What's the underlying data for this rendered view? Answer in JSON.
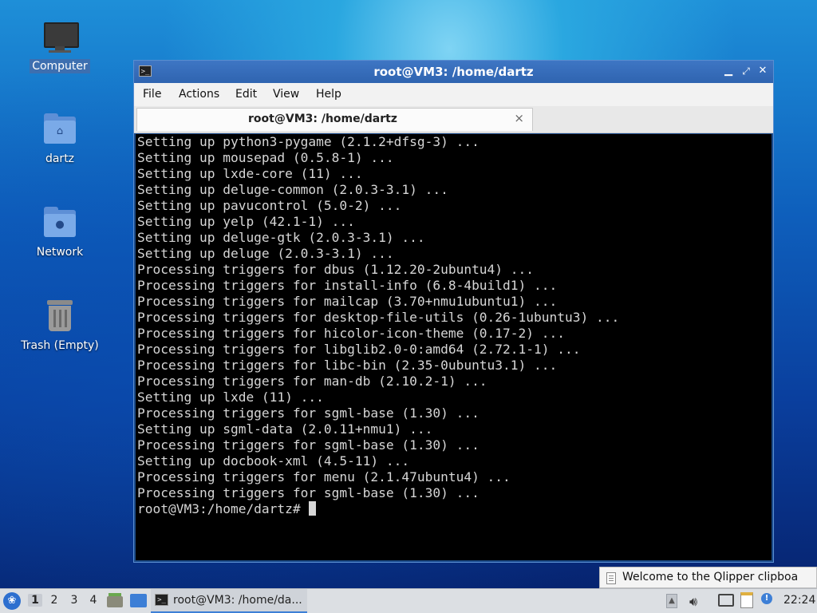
{
  "desktop": {
    "icons": [
      {
        "label": "Computer"
      },
      {
        "label": "dartz"
      },
      {
        "label": "Network"
      },
      {
        "label": "Trash (Empty)"
      }
    ]
  },
  "window": {
    "title": "root@VM3: /home/dartz",
    "menu": [
      "File",
      "Actions",
      "Edit",
      "View",
      "Help"
    ],
    "tab_label": "root@VM3: /home/dartz",
    "terminal_lines": [
      "Setting up python3-pygame (2.1.2+dfsg-3) ...",
      "Setting up mousepad (0.5.8-1) ...",
      "Setting up lxde-core (11) ...",
      "Setting up deluge-common (2.0.3-3.1) ...",
      "Setting up pavucontrol (5.0-2) ...",
      "Setting up yelp (42.1-1) ...",
      "Setting up deluge-gtk (2.0.3-3.1) ...",
      "Setting up deluge (2.0.3-3.1) ...",
      "Processing triggers for dbus (1.12.20-2ubuntu4) ...",
      "Processing triggers for install-info (6.8-4build1) ...",
      "Processing triggers for mailcap (3.70+nmu1ubuntu1) ...",
      "Processing triggers for desktop-file-utils (0.26-1ubuntu3) ...",
      "Processing triggers for hicolor-icon-theme (0.17-2) ...",
      "Processing triggers for libglib2.0-0:amd64 (2.72.1-1) ...",
      "Processing triggers for libc-bin (2.35-0ubuntu3.1) ...",
      "Processing triggers for man-db (2.10.2-1) ...",
      "Setting up lxde (11) ...",
      "Processing triggers for sgml-base (1.30) ...",
      "Setting up sgml-data (2.0.11+nmu1) ...",
      "Processing triggers for sgml-base (1.30) ...",
      "Setting up docbook-xml (4.5-11) ...",
      "Processing triggers for menu (2.1.47ubuntu4) ...",
      "Processing triggers for sgml-base (1.30) ..."
    ],
    "prompt": "root@VM3:/home/dartz# "
  },
  "notification": {
    "text": "Welcome to the Qlipper clipboa"
  },
  "taskbar": {
    "desktops": [
      "1",
      "2",
      "3",
      "4"
    ],
    "active_desktop": "1",
    "task_label": "root@VM3: /home/da...",
    "clock": "22:24"
  },
  "colors": {
    "titlebar": "#3e76c4",
    "terminal_bg": "#000000",
    "terminal_fg": "#d6d6d6",
    "selection": "#3d6fb0"
  }
}
